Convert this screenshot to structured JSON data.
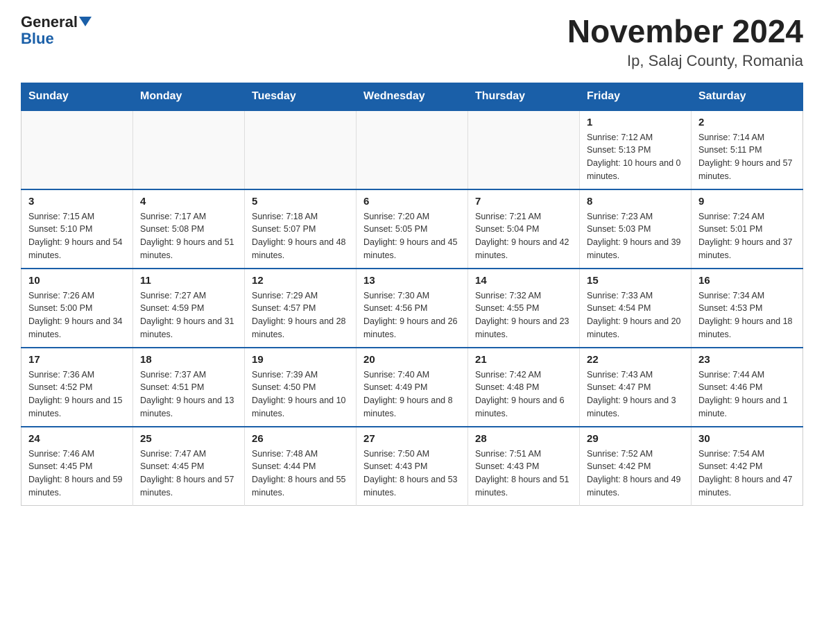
{
  "logo": {
    "general": "General",
    "blue": "Blue"
  },
  "title": "November 2024",
  "subtitle": "Ip, Salaj County, Romania",
  "weekdays": [
    "Sunday",
    "Monday",
    "Tuesday",
    "Wednesday",
    "Thursday",
    "Friday",
    "Saturday"
  ],
  "weeks": [
    [
      {
        "day": "",
        "info": ""
      },
      {
        "day": "",
        "info": ""
      },
      {
        "day": "",
        "info": ""
      },
      {
        "day": "",
        "info": ""
      },
      {
        "day": "",
        "info": ""
      },
      {
        "day": "1",
        "info": "Sunrise: 7:12 AM\nSunset: 5:13 PM\nDaylight: 10 hours and 0 minutes."
      },
      {
        "day": "2",
        "info": "Sunrise: 7:14 AM\nSunset: 5:11 PM\nDaylight: 9 hours and 57 minutes."
      }
    ],
    [
      {
        "day": "3",
        "info": "Sunrise: 7:15 AM\nSunset: 5:10 PM\nDaylight: 9 hours and 54 minutes."
      },
      {
        "day": "4",
        "info": "Sunrise: 7:17 AM\nSunset: 5:08 PM\nDaylight: 9 hours and 51 minutes."
      },
      {
        "day": "5",
        "info": "Sunrise: 7:18 AM\nSunset: 5:07 PM\nDaylight: 9 hours and 48 minutes."
      },
      {
        "day": "6",
        "info": "Sunrise: 7:20 AM\nSunset: 5:05 PM\nDaylight: 9 hours and 45 minutes."
      },
      {
        "day": "7",
        "info": "Sunrise: 7:21 AM\nSunset: 5:04 PM\nDaylight: 9 hours and 42 minutes."
      },
      {
        "day": "8",
        "info": "Sunrise: 7:23 AM\nSunset: 5:03 PM\nDaylight: 9 hours and 39 minutes."
      },
      {
        "day": "9",
        "info": "Sunrise: 7:24 AM\nSunset: 5:01 PM\nDaylight: 9 hours and 37 minutes."
      }
    ],
    [
      {
        "day": "10",
        "info": "Sunrise: 7:26 AM\nSunset: 5:00 PM\nDaylight: 9 hours and 34 minutes."
      },
      {
        "day": "11",
        "info": "Sunrise: 7:27 AM\nSunset: 4:59 PM\nDaylight: 9 hours and 31 minutes."
      },
      {
        "day": "12",
        "info": "Sunrise: 7:29 AM\nSunset: 4:57 PM\nDaylight: 9 hours and 28 minutes."
      },
      {
        "day": "13",
        "info": "Sunrise: 7:30 AM\nSunset: 4:56 PM\nDaylight: 9 hours and 26 minutes."
      },
      {
        "day": "14",
        "info": "Sunrise: 7:32 AM\nSunset: 4:55 PM\nDaylight: 9 hours and 23 minutes."
      },
      {
        "day": "15",
        "info": "Sunrise: 7:33 AM\nSunset: 4:54 PM\nDaylight: 9 hours and 20 minutes."
      },
      {
        "day": "16",
        "info": "Sunrise: 7:34 AM\nSunset: 4:53 PM\nDaylight: 9 hours and 18 minutes."
      }
    ],
    [
      {
        "day": "17",
        "info": "Sunrise: 7:36 AM\nSunset: 4:52 PM\nDaylight: 9 hours and 15 minutes."
      },
      {
        "day": "18",
        "info": "Sunrise: 7:37 AM\nSunset: 4:51 PM\nDaylight: 9 hours and 13 minutes."
      },
      {
        "day": "19",
        "info": "Sunrise: 7:39 AM\nSunset: 4:50 PM\nDaylight: 9 hours and 10 minutes."
      },
      {
        "day": "20",
        "info": "Sunrise: 7:40 AM\nSunset: 4:49 PM\nDaylight: 9 hours and 8 minutes."
      },
      {
        "day": "21",
        "info": "Sunrise: 7:42 AM\nSunset: 4:48 PM\nDaylight: 9 hours and 6 minutes."
      },
      {
        "day": "22",
        "info": "Sunrise: 7:43 AM\nSunset: 4:47 PM\nDaylight: 9 hours and 3 minutes."
      },
      {
        "day": "23",
        "info": "Sunrise: 7:44 AM\nSunset: 4:46 PM\nDaylight: 9 hours and 1 minute."
      }
    ],
    [
      {
        "day": "24",
        "info": "Sunrise: 7:46 AM\nSunset: 4:45 PM\nDaylight: 8 hours and 59 minutes."
      },
      {
        "day": "25",
        "info": "Sunrise: 7:47 AM\nSunset: 4:45 PM\nDaylight: 8 hours and 57 minutes."
      },
      {
        "day": "26",
        "info": "Sunrise: 7:48 AM\nSunset: 4:44 PM\nDaylight: 8 hours and 55 minutes."
      },
      {
        "day": "27",
        "info": "Sunrise: 7:50 AM\nSunset: 4:43 PM\nDaylight: 8 hours and 53 minutes."
      },
      {
        "day": "28",
        "info": "Sunrise: 7:51 AM\nSunset: 4:43 PM\nDaylight: 8 hours and 51 minutes."
      },
      {
        "day": "29",
        "info": "Sunrise: 7:52 AM\nSunset: 4:42 PM\nDaylight: 8 hours and 49 minutes."
      },
      {
        "day": "30",
        "info": "Sunrise: 7:54 AM\nSunset: 4:42 PM\nDaylight: 8 hours and 47 minutes."
      }
    ]
  ]
}
